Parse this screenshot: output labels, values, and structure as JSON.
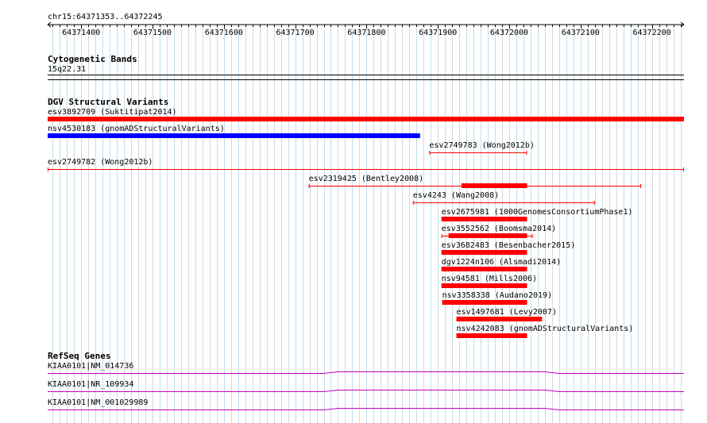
{
  "view": {
    "chrom": "chr15",
    "start": 64371353,
    "end": 64372245,
    "location_label": "chr15:64371353..64372245"
  },
  "ruler": {
    "ticks": [
      {
        "pos": 64371400,
        "label": "64371400"
      },
      {
        "pos": 64371500,
        "label": "64371500"
      },
      {
        "pos": 64371600,
        "label": "64371600"
      },
      {
        "pos": 64371700,
        "label": "64371700"
      },
      {
        "pos": 64371800,
        "label": "64371800"
      },
      {
        "pos": 64371900,
        "label": "64371900"
      },
      {
        "pos": 64372000,
        "label": "64372000"
      },
      {
        "pos": 64372100,
        "label": "64372100"
      },
      {
        "pos": 64372200,
        "label": "64372200"
      }
    ]
  },
  "tracks": {
    "cytoband": {
      "title": "Cytogenetic Bands",
      "band_label": "15q22.31"
    },
    "dgv": {
      "title": "DGV Structural Variants",
      "variants": [
        {
          "label": "esv3892709 (Suktitipat2014)",
          "start": 64371353,
          "end": 64372245,
          "color": "#ff0000",
          "style": "bar"
        },
        {
          "label": "nsv4530183 (gnomADStructuralVariants)",
          "start": 64371353,
          "end": 64371875,
          "color": "#0000ff",
          "style": "bar"
        },
        {
          "label": "esv2749783 (Wong2012b)",
          "start": 64371888,
          "end": 64372025,
          "color": "#ff0000",
          "style": "line"
        },
        {
          "label": "esv2749782 (Wong2012b)",
          "start": 64371353,
          "end": 64372245,
          "color": "#ff0000",
          "style": "line"
        },
        {
          "label": "esv2319425 (Bentley2008)",
          "start": 64371719,
          "end": 64372185,
          "color": "#ff0000",
          "style": "core",
          "core_start": 64371933,
          "core_end": 64372025
        },
        {
          "label": "esv4243 (Wang2008)",
          "start": 64371865,
          "end": 64372120,
          "color": "#ff0000",
          "style": "line"
        },
        {
          "label": "esv2675981 (1000GenomesConsortiumPhase1)",
          "start": 64371905,
          "end": 64372025,
          "color": "#ff0000",
          "style": "bar"
        },
        {
          "label": "esv3552562 (Boomsma2014)",
          "start": 64371905,
          "end": 64372033,
          "color": "#ff0000",
          "style": "core",
          "core_start": 64371915,
          "core_end": 64372025
        },
        {
          "label": "esv3682483 (Besenbacher2015)",
          "start": 64371905,
          "end": 64372025,
          "color": "#ff0000",
          "style": "bar"
        },
        {
          "label": "dgv1224n106 (Alsmadi2014)",
          "start": 64371905,
          "end": 64372025,
          "color": "#ff0000",
          "style": "bar"
        },
        {
          "label": "nsv94581 (Mills2006)",
          "start": 64371905,
          "end": 64372025,
          "color": "#ff0000",
          "style": "bar"
        },
        {
          "label": "nsv3358338 (Audano2019)",
          "start": 64371906,
          "end": 64372025,
          "color": "#ff0000",
          "style": "bar"
        },
        {
          "label": "esv1497681 (Levy2007)",
          "start": 64371926,
          "end": 64372046,
          "color": "#ff0000",
          "style": "bar"
        },
        {
          "label": "nsv4242083 (gnomADStructuralVariants)",
          "start": 64371926,
          "end": 64372025,
          "color": "#ff0000",
          "style": "bar"
        }
      ]
    },
    "refseq": {
      "title": "RefSeq Genes",
      "color": "#c000c0",
      "genes": [
        {
          "label": "KIAA0101|NM_014736"
        },
        {
          "label": "KIAA0101|NR_109934"
        },
        {
          "label": "KIAA0101|NM_001029989"
        }
      ]
    }
  }
}
